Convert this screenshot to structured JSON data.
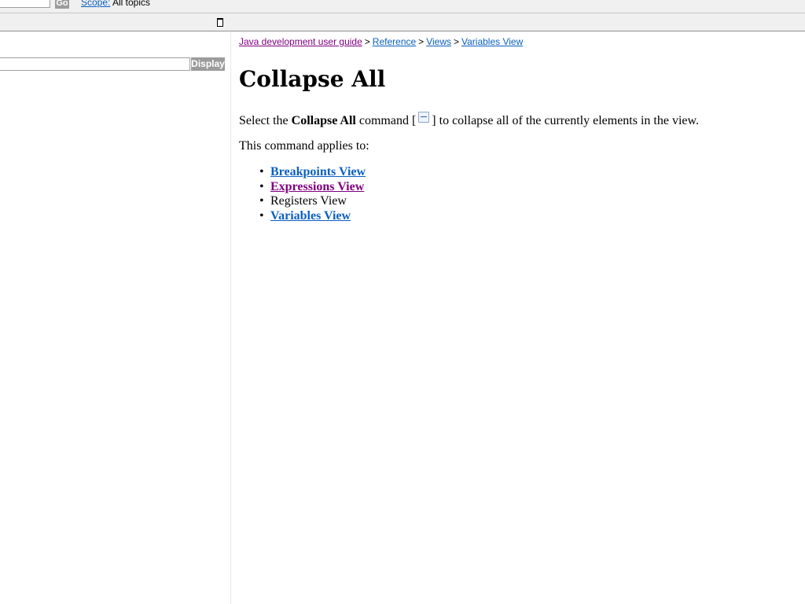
{
  "topbar": {
    "go_label": "Go",
    "scope_label": "Scope:",
    "scope_value": "All topics"
  },
  "left_pane": {
    "display_label": "Display",
    "cut_text": ":"
  },
  "breadcrumb": {
    "items": [
      "Java development user guide",
      "Reference",
      "Views",
      "Variables View"
    ],
    "separator": ">"
  },
  "page": {
    "title": "Collapse All",
    "intro_before": "Select the ",
    "intro_bold": "Collapse All",
    "intro_middle": " command [",
    "intro_after": "] to collapse all of the currently elements in the view.",
    "applies_to": "This command applies to:",
    "bullet": "•",
    "applies_list": [
      {
        "label": "Breakpoints View",
        "link": true,
        "visited": false
      },
      {
        "label": "Expressions View",
        "link": true,
        "visited": true
      },
      {
        "label": "Registers View",
        "link": false,
        "visited": false
      },
      {
        "label": "Variables View",
        "link": true,
        "visited": false
      }
    ]
  },
  "icons": {
    "collapse_all": "collapse-all-icon",
    "maximize": "maximize-icon"
  },
  "colors": {
    "link": "#0b5fc1",
    "visited": "#800080",
    "button_bg": "#9b9b9b",
    "toolbar_bg": "#f0f0f0"
  }
}
